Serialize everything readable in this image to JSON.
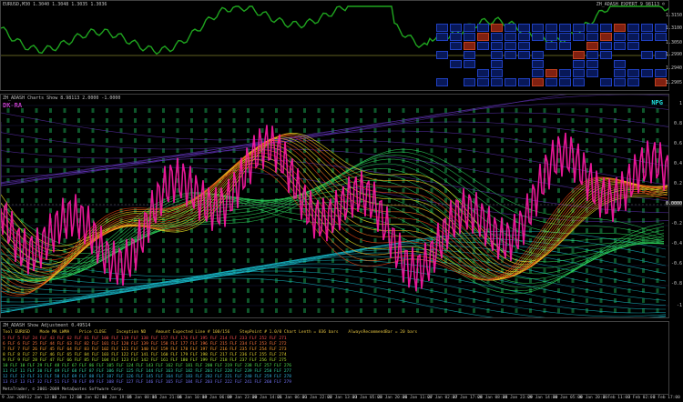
{
  "pane1": {
    "title": "EURUSD,M30  1.3040 1.3048 1.3035 1.3036",
    "title_right": "ZH_ADASH EXPERT 9 98113 ☺",
    "axis": [
      "1.3150",
      "1.3100",
      "1.3050",
      "1.2990",
      "1.2940",
      "1.2905"
    ]
  },
  "pane2": {
    "title": "ZH_ADASH Charts Show 8.98113 2.0000 -1.0000",
    "tag_left": "DK-RA",
    "tag_right": "NPG",
    "axis": [
      "1",
      "0.8",
      "0.6",
      "0.4",
      "0.2",
      "0.0000",
      "-0.2",
      "-0.4",
      "-0.6",
      "-0.8",
      "-1"
    ]
  },
  "pane3": {
    "title": "ZH_ADASH Show Adjustment 0.49514",
    "header": [
      "Tool EURUSD",
      "Mode MA LWMA",
      "Price CLOSE",
      "Inception ND",
      "Amount Expected Line # 100/156",
      "StepPoint # 1.0/0 Chart Lenth = 836 bars",
      "AlwaysRecommendBar = 20 bars"
    ],
    "rows": [
      "5  FLF 5   FLF 24  FLF 43  FLF 62  FLF 81  FLF 100  FLF 119  FLF 138  FLF 157  FLF 176  FLF 195  FLF 214  FLF 233  FLF 252  FLF 271",
      "6  FLF 6   FLF 25  FLF 44  FLF 63  FLF 82  FLF 101  FLF 120  FLF 139  FLF 158  FLF 177  FLF 196  FLF 215  FLF 234  FLF 253  FLF 272",
      "7  FLF 7   FLF 26  FLF 45  FLF 64  FLF 83  FLF 102  FLF 121  FLF 140  FLF 159  FLF 178  FLF 197  FLF 216  FLF 235  FLF 254  FLF 273",
      "8  FLF 8   FLF 27  FLF 46  FLF 65  FLF 84  FLF 103  FLF 122  FLF 141  FLF 160  FLF 179  FLF 198  FLF 217  FLF 236  FLF 255  FLF 274",
      "9  FLF 9   FLF 28  FLF 47  FLF 66  FLF 85  FLF 104  FLF 123  FLF 142  FLF 161  FLF 180  FLF 199  FLF 218  FLF 237  FLF 256  FLF 275",
      "10 FLF 10  FLF 29  FLF 48  FLF 67  FLF 86  FLF 105  FLF 124  FLF 143  FLF 162  FLF 181  FLF 200  FLF 219  FLF 238  FLF 257  FLF 276",
      "11 FLF 11  FLF 30  FLF 49  FLF 68  FLF 87  FLF 106  FLF 125  FLF 144  FLF 163  FLF 182  FLF 201  FLF 220  FLF 239  FLF 258  FLF 277",
      "12 FLF 12  FLF 31  FLF 50  FLF 69  FLF 88  FLF 107  FLF 126  FLF 145  FLF 164  FLF 183  FLF 202  FLF 221  FLF 240  FLF 259  FLF 278",
      "13 FLF 13  FLF 32  FLF 51  FLF 70  FLF 89  FLF 108  FLF 127  FLF 146  FLF 165  FLF 184  FLF 203  FLF 222  FLF 241  FLF 260  FLF 279"
    ],
    "footer": "MetaTrader, © 2001-2009 MetaQuotes Software Corp."
  },
  "time_axis": [
    "9 Jan 2009",
    "12 Jan 13:00",
    "13 Jan 12:00",
    "14 Jan 02:00",
    "14 Jan 19:00",
    "15 Jan 08:00",
    "15 Jan 21:00",
    "16 Jan 10:00",
    "19 Jan 06:00",
    "19 Jan 23:00",
    "20 Jan 14:00",
    "21 Jan 06:00",
    "21 Jan 22:00",
    "22 Jan 13:00",
    "23 Jan 05:00",
    "23 Jan 20:00",
    "26 Jan 11:00",
    "27 Jan 02:00",
    "27 Jan 17:00",
    "28 Jan 08:00",
    "28 Jan 23:00",
    "29 Jan 14:00",
    "30 Jan 05:00",
    "30 Jan 20:00",
    "2 Feb 11:00",
    "3 Feb 02:00",
    "3 Feb 17:00"
  ],
  "colors": {
    "price_line": "#1fa51f",
    "magenta": "#ff1aa6",
    "yellow": "#e6e61a",
    "green": "#2ee65a",
    "cyan": "#1ac8d0",
    "purple": "#7a3ad8"
  }
}
